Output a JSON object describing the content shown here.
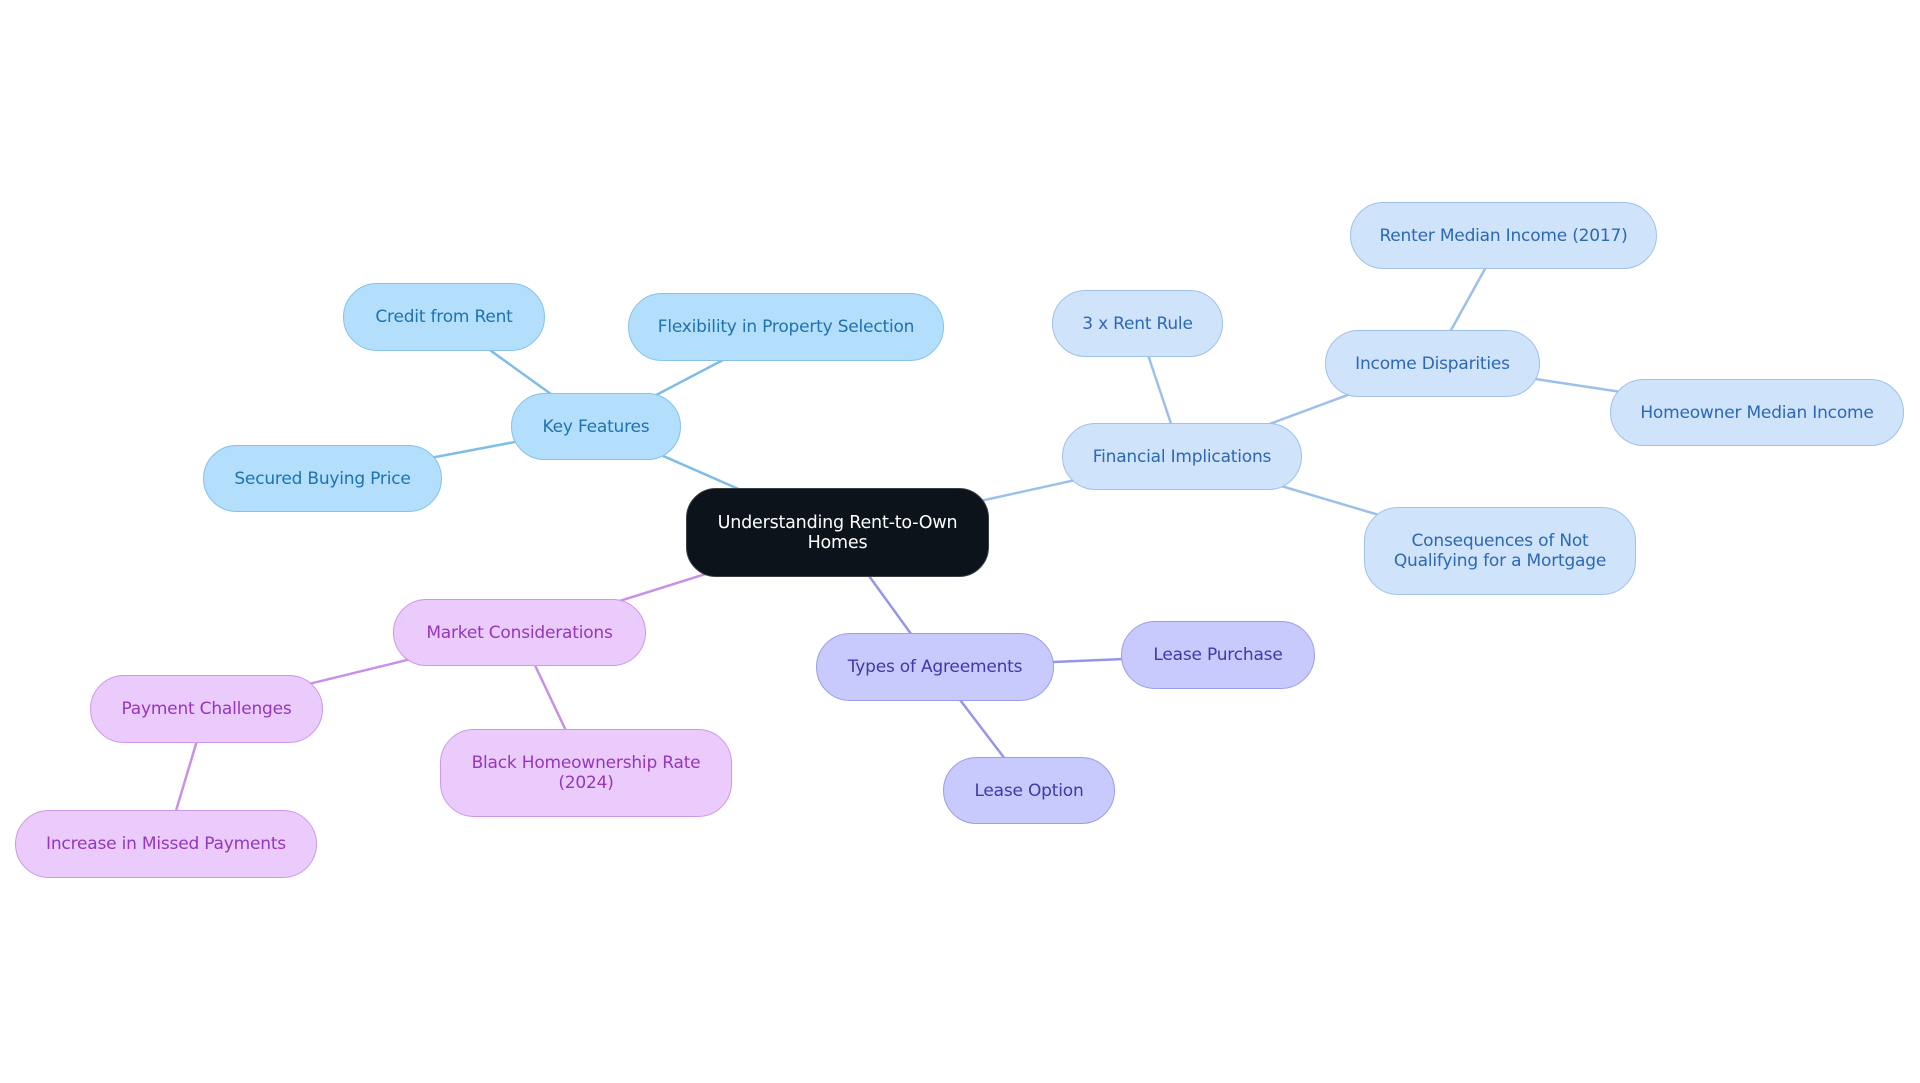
{
  "title": "Understanding Rent-to-Own Homes",
  "colors": {
    "root_bg": "#0d131b",
    "key_features": "#b3defc",
    "financial_implications": "#cfe3fb",
    "types_of_agreements": "#c8c9fc",
    "market_considerations": "#eacbfc",
    "edge_key_features": "#7fbde6",
    "edge_financial": "#9cc0e8",
    "edge_types": "#9796e6",
    "edge_market": "#c891e6"
  },
  "nodes": {
    "root": {
      "label": "Understanding Rent-to-Own Homes"
    },
    "key_features": {
      "label": "Key Features"
    },
    "credit_from_rent": {
      "label": "Credit from Rent"
    },
    "flexibility": {
      "label": "Flexibility in Property Selection"
    },
    "secured_price": {
      "label": "Secured Buying Price"
    },
    "financial": {
      "label": "Financial Implications"
    },
    "rent_rule": {
      "label": "3 x Rent Rule"
    },
    "income_disparities": {
      "label": "Income Disparities"
    },
    "renter_income": {
      "label": "Renter Median Income (2017)"
    },
    "homeowner_income": {
      "label": "Homeowner Median Income"
    },
    "consequences": {
      "label": "Consequences of Not Qualifying for a Mortgage"
    },
    "types": {
      "label": "Types of Agreements"
    },
    "lease_purchase": {
      "label": "Lease Purchase"
    },
    "lease_option": {
      "label": "Lease Option"
    },
    "market": {
      "label": "Market Considerations"
    },
    "payment_challenges": {
      "label": "Payment Challenges"
    },
    "missed_payments": {
      "label": "Increase in Missed Payments"
    },
    "black_homeownership": {
      "label": "Black Homeownership Rate (2024)"
    }
  },
  "edges": [
    {
      "from": "root",
      "to": "key_features",
      "branch": "edge_key_features"
    },
    {
      "from": "key_features",
      "to": "credit_from_rent",
      "branch": "edge_key_features"
    },
    {
      "from": "key_features",
      "to": "flexibility",
      "branch": "edge_key_features"
    },
    {
      "from": "key_features",
      "to": "secured_price",
      "branch": "edge_key_features"
    },
    {
      "from": "root",
      "to": "financial",
      "branch": "edge_financial"
    },
    {
      "from": "financial",
      "to": "rent_rule",
      "branch": "edge_financial"
    },
    {
      "from": "financial",
      "to": "income_disparities",
      "branch": "edge_financial"
    },
    {
      "from": "income_disparities",
      "to": "renter_income",
      "branch": "edge_financial"
    },
    {
      "from": "income_disparities",
      "to": "homeowner_income",
      "branch": "edge_financial"
    },
    {
      "from": "financial",
      "to": "consequences",
      "branch": "edge_financial"
    },
    {
      "from": "root",
      "to": "types",
      "branch": "edge_types"
    },
    {
      "from": "types",
      "to": "lease_purchase",
      "branch": "edge_types"
    },
    {
      "from": "types",
      "to": "lease_option",
      "branch": "edge_types"
    },
    {
      "from": "root",
      "to": "market",
      "branch": "edge_market"
    },
    {
      "from": "market",
      "to": "payment_challenges",
      "branch": "edge_market"
    },
    {
      "from": "payment_challenges",
      "to": "missed_payments",
      "branch": "edge_market"
    },
    {
      "from": "market",
      "to": "black_homeownership",
      "branch": "edge_market"
    }
  ]
}
